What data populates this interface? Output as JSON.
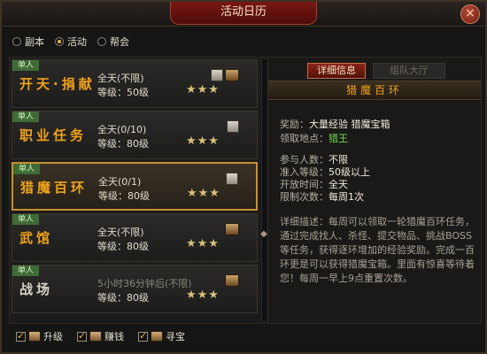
{
  "window": {
    "title": "活动日历",
    "close_glyph": "×"
  },
  "top_tabs": [
    {
      "label": "副本",
      "selected": false
    },
    {
      "label": "活动",
      "selected": true
    },
    {
      "label": "帮会",
      "selected": false
    }
  ],
  "entries": [
    {
      "tag": "单人",
      "name": "开天·捐献",
      "time": "全天(不限)",
      "level": "等级：50级",
      "stars": 3,
      "stars_text": "★★★"
    },
    {
      "tag": "单人",
      "name": "职业任务",
      "time": "全天(0/10)",
      "level": "等级：80级",
      "stars": 2.5,
      "stars_text": "★★★"
    },
    {
      "tag": "单人",
      "name": "猎魔百环",
      "time": "全天(0/1)",
      "level": "等级：80级",
      "stars": 2.5,
      "stars_text": "★★★"
    },
    {
      "tag": "单人",
      "name": "武馆",
      "time": "全天(不限)",
      "level": "等级：80级",
      "stars": 2,
      "stars_text": "★★★"
    },
    {
      "tag": "单人",
      "name": "战场",
      "time": "5小时36分钟后(不限)",
      "level": "等级：80级",
      "stars": 2.5,
      "stars_text": "★★★"
    }
  ],
  "details": {
    "tab_active": "详细信息",
    "tab_inactive": "组队大厅",
    "header": "猎魔百环",
    "reward_label": "奖励：",
    "reward_value": "大量经验  猎魔宝箱",
    "location_label": "领取地点：",
    "location_value": "猎王",
    "participants_label": "参与人数：",
    "participants_value": "不限",
    "req_level_label": "准入等级：",
    "req_level_value": "50级以上",
    "open_time_label": "开放时间：",
    "open_time_value": "全天",
    "limit_label": "限制次数：",
    "limit_value": "每周1次",
    "description": "详细描述：每周可以领取一轮猎魔百环任务，通过完成找人、杀怪、提交物品、挑战BOSS等任务，获得逐环增加的经验奖励。完成一百环更是可以获得猎魔宝箱。里面有惊喜等待着您！每周一早上9点重置次数。"
  },
  "filters": [
    {
      "label": "升级",
      "checked": true,
      "icon": "book-icon"
    },
    {
      "label": "赚钱",
      "checked": true,
      "icon": "money-icon"
    },
    {
      "label": "寻宝",
      "checked": true,
      "icon": "treasure-icon"
    }
  ]
}
